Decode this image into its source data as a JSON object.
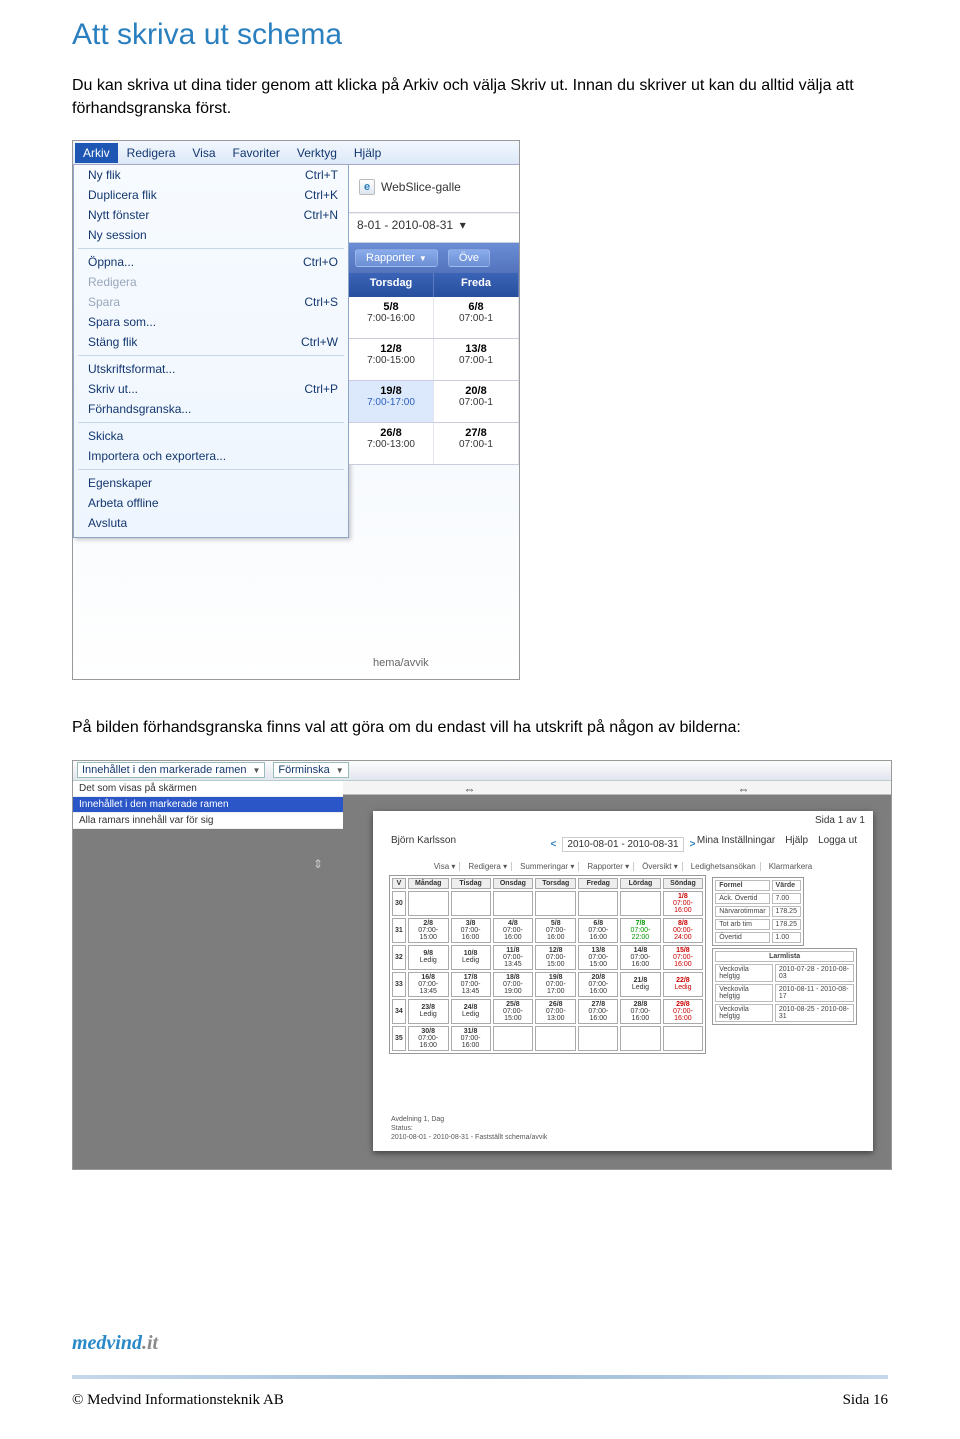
{
  "title": "Att skriva ut schema",
  "intro": "Du kan skriva ut dina tider genom att klicka på Arkiv och välja Skriv ut. Innan du skriver ut kan du alltid välja att förhandsgranska först.",
  "mid_text": "På bilden förhandsgranska finns val att göra om du endast vill ha utskrift på någon av bilderna:",
  "menubar": [
    "Arkiv",
    "Redigera",
    "Visa",
    "Favoriter",
    "Verktyg",
    "Hjälp"
  ],
  "arkiv_menu": [
    {
      "label": "Ny flik",
      "sc": "Ctrl+T"
    },
    {
      "label": "Duplicera flik",
      "sc": "Ctrl+K"
    },
    {
      "label": "Nytt fönster",
      "sc": "Ctrl+N"
    },
    {
      "label": "Ny session",
      "sc": ""
    },
    {
      "sep": true
    },
    {
      "label": "Öppna...",
      "sc": "Ctrl+O"
    },
    {
      "label": "Redigera",
      "sc": "",
      "disabled": true
    },
    {
      "label": "Spara",
      "sc": "Ctrl+S",
      "disabled": true
    },
    {
      "label": "Spara som...",
      "sc": ""
    },
    {
      "label": "Stäng flik",
      "sc": "Ctrl+W"
    },
    {
      "sep": true
    },
    {
      "label": "Utskriftsformat...",
      "sc": ""
    },
    {
      "label": "Skriv ut...",
      "sc": "Ctrl+P"
    },
    {
      "label": "Förhandsgranska...",
      "sc": ""
    },
    {
      "sep": true
    },
    {
      "label": "Skicka",
      "sc": ""
    },
    {
      "label": "Importera och exportera...",
      "sc": ""
    },
    {
      "sep": true
    },
    {
      "label": "Egenskaper",
      "sc": ""
    },
    {
      "label": "Arbeta offline",
      "sc": ""
    },
    {
      "label": "Avsluta",
      "sc": ""
    }
  ],
  "webslice": "WebSlice-galle",
  "date_range": "8-01 - 2010-08-31",
  "bluerow": {
    "rapporter": "Rapporter",
    "ove": "Öve"
  },
  "dayheaders": [
    "Torsdag",
    "Freda"
  ],
  "gridrows": [
    {
      "cells": [
        {
          "d": "5/8",
          "t": "7:00-16:00"
        },
        {
          "d": "6/8",
          "t": "07:00-1"
        }
      ]
    },
    {
      "cells": [
        {
          "d": "12/8",
          "t": "7:00-15:00"
        },
        {
          "d": "13/8",
          "t": "07:00-1"
        }
      ]
    },
    {
      "cells": [
        {
          "d": "19/8",
          "t": "7:00-17:00",
          "sel": true
        },
        {
          "d": "20/8",
          "t": "07:00-1"
        }
      ]
    },
    {
      "cells": [
        {
          "d": "26/8",
          "t": "7:00-13:00"
        },
        {
          "d": "27/8",
          "t": "07:00-1"
        }
      ]
    }
  ],
  "status_line": "hema/avvik",
  "pv": {
    "combo": "Innehållet i den markerade ramen",
    "forminska": "Förminska",
    "opts": [
      "Det som visas på skärmen",
      "Innehållet i den markerade ramen",
      "Alla ramars innehåll var för sig"
    ],
    "sida": "Sida 1 av 1",
    "name": "Björn Karlsson",
    "range": "2010-08-01 - 2010-08-31",
    "links": [
      "Mina Inställningar",
      "Hjälp",
      "Logga ut"
    ],
    "subbar": [
      "Visa ▾",
      "Redigera ▾",
      "Summeringar ▾",
      "Rapporter ▾",
      "Översikt ▾",
      "Ledighetsansökan",
      "Klarmarkera"
    ],
    "cal_headers": [
      "V",
      "Måndag",
      "Tisdag",
      "Onsdag",
      "Torsdag",
      "Fredag",
      "Lördag",
      "Söndag"
    ],
    "cal": [
      {
        "w": "30",
        "c": [
          "",
          "",
          "",
          "",
          "",
          "",
          "1/8 07:00-16:00"
        ],
        "suncls": [
          "",
          "",
          "",
          "",
          "",
          "",
          "sun"
        ]
      },
      {
        "w": "31",
        "c": [
          "2/8 07:00-15:00",
          "3/8 07:00-16:00",
          "4/8 07:00-16:00",
          "5/8 07:00-16:00",
          "6/8 07:00-16:00",
          "7/8 07:00-22:00",
          "8/8 00:00-24:00"
        ],
        "suncls": [
          "",
          "",
          "",
          "",
          "",
          "grn",
          "sun"
        ]
      },
      {
        "w": "32",
        "c": [
          "9/8 Ledig",
          "10/8 Ledig",
          "11/8 07:00-13:45",
          "12/8 07:00-15:00",
          "13/8 07:00-15:00",
          "14/8 07:00-16:00",
          "15/8 07:00-16:00"
        ],
        "suncls": [
          "",
          "",
          "",
          "",
          "",
          "",
          "sun"
        ]
      },
      {
        "w": "33",
        "c": [
          "16/8 07:00-13:45",
          "17/8 07:00-13:45",
          "18/8 07:00-19:00",
          "19/8 07:00-17:00",
          "20/8 07:00-16:00",
          "21/8 Ledig",
          "22/8 Ledig"
        ],
        "suncls": [
          "",
          "",
          "",
          "",
          "",
          "",
          "sun"
        ]
      },
      {
        "w": "34",
        "c": [
          "23/8 Ledig",
          "24/8 Ledig",
          "25/8 07:00-15:00",
          "26/8 07:00-13:00",
          "27/8 07:00-16:00",
          "28/8 07:00-16:00",
          "29/8 07:00-16:00"
        ],
        "suncls": [
          "",
          "",
          "",
          "",
          "",
          "",
          "sun"
        ]
      },
      {
        "w": "35",
        "c": [
          "30/8 07:00-16:00",
          "31/8 07:00-16:00",
          "",
          "",
          "",
          "",
          ""
        ],
        "suncls": [
          "",
          "",
          "",
          "",
          "",
          "",
          ""
        ]
      }
    ],
    "info": [
      [
        "Formel",
        "Värde"
      ],
      [
        "Ack. Övertid",
        "7.00"
      ],
      [
        "Närvarotimmar",
        "178.25"
      ],
      [
        "Tot arb tim",
        "178.25"
      ],
      [
        "Övertid",
        "1.00"
      ]
    ],
    "larm_title": "Larmlista",
    "larm": [
      [
        "Veckovila helgtjg",
        "2010-07-28 - 2010-08-03"
      ],
      [
        "Veckovila helgtjg",
        "2010-08-11 - 2010-08-17"
      ],
      [
        "Veckovila helgtjg",
        "2010-08-25 - 2010-08-31"
      ]
    ],
    "footer": [
      "Avdelning 1, Dag",
      "Status:",
      "2010-08-01 - 2010-08-31 - Fastställt schema/avvik"
    ]
  },
  "logo": {
    "m": "medvind",
    "d": ".it"
  },
  "copyright": "© Medvind Informationsteknik AB",
  "pagenum": "Sida 16"
}
